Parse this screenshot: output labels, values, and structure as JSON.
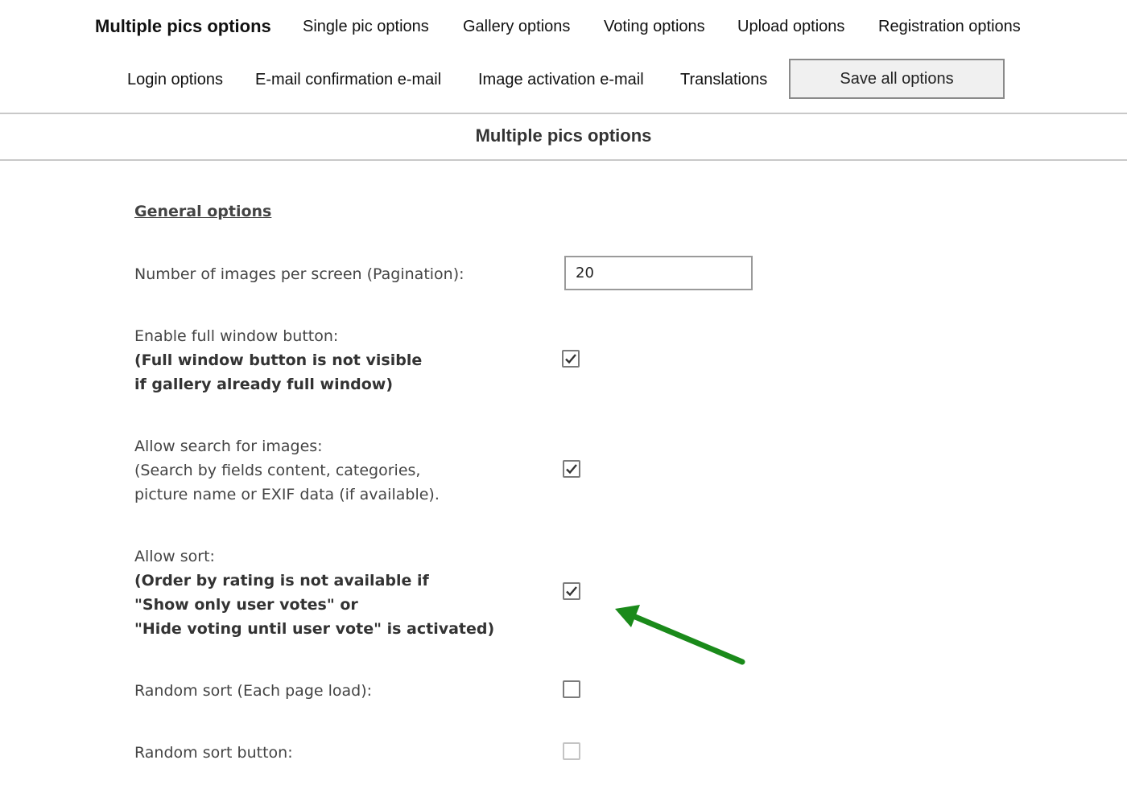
{
  "tabs": [
    {
      "label": "Multiple pics options",
      "active": true
    },
    {
      "label": "Single pic options"
    },
    {
      "label": "Gallery options"
    },
    {
      "label": "Voting options"
    },
    {
      "label": "Upload options"
    },
    {
      "label": "Registration options"
    },
    {
      "label": "Login options"
    },
    {
      "label": "E-mail confirmation e-mail"
    },
    {
      "label": "Image activation e-mail"
    },
    {
      "label": "Translations"
    }
  ],
  "save_button": "Save all options",
  "section_title": "Multiple pics options",
  "subsection_title": "General options",
  "options": {
    "pagination": {
      "label": "Number of images per screen (Pagination):",
      "value": "20"
    },
    "full_window": {
      "label": "Enable full window button:",
      "note_lines": [
        "(Full window button is not visible",
        "if gallery already full window)"
      ],
      "checked": true
    },
    "search": {
      "label": "Allow search for images:",
      "note_lines": [
        "(Search by fields content, categories,",
        "picture name or EXIF data (if available)."
      ],
      "checked": true
    },
    "sort": {
      "label": "Allow sort:",
      "note_lines": [
        "(Order by rating is not available if",
        "\"Show only user votes\" or",
        "\"Hide voting until user vote\" is activated)"
      ],
      "checked": true
    },
    "random_sort": {
      "label": "Random sort (Each page load):",
      "checked": false
    },
    "random_sort_button": {
      "label": "Random sort button:",
      "checked": false,
      "disabled": true
    }
  },
  "colors": {
    "annotation_arrow": "#1a8a1a",
    "divider": "#c8c8c8",
    "button_bg": "#f0f0f0"
  }
}
